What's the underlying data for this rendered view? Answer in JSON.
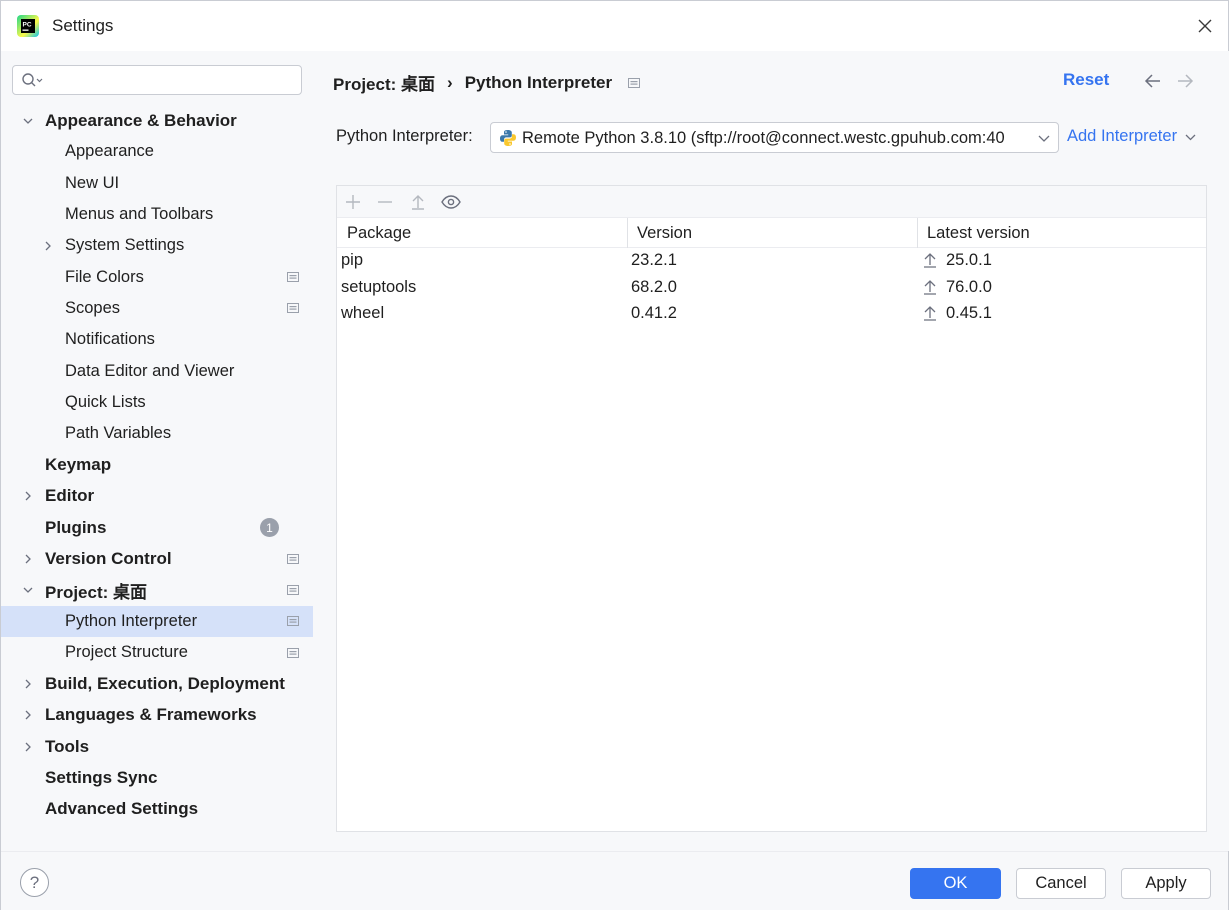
{
  "window": {
    "title": "Settings"
  },
  "search": {
    "placeholder": "",
    "value": ""
  },
  "sidebar": {
    "items": [
      {
        "label": "Appearance & Behavior",
        "level": 0,
        "chevron": "down"
      },
      {
        "label": "Appearance",
        "level": 1
      },
      {
        "label": "New UI",
        "level": 1
      },
      {
        "label": "Menus and Toolbars",
        "level": 1
      },
      {
        "label": "System Settings",
        "level": 1,
        "chevron": "right"
      },
      {
        "label": "File Colors",
        "level": 1,
        "badge": "project-scope-icon"
      },
      {
        "label": "Scopes",
        "level": 1,
        "badge": "project-scope-icon"
      },
      {
        "label": "Notifications",
        "level": 1
      },
      {
        "label": "Data Editor and Viewer",
        "level": 1
      },
      {
        "label": "Quick Lists",
        "level": 1
      },
      {
        "label": "Path Variables",
        "level": 1
      },
      {
        "label": "Keymap",
        "level": 0
      },
      {
        "label": "Editor",
        "level": 0,
        "chevron": "right"
      },
      {
        "label": "Plugins",
        "level": 0,
        "count": "1"
      },
      {
        "label": "Version Control",
        "level": 0,
        "chevron": "right",
        "badge": "project-scope-icon"
      },
      {
        "label": "Project: 桌面",
        "level": 0,
        "chevron": "down",
        "badge": "project-scope-icon"
      },
      {
        "label": "Python Interpreter",
        "level": 1,
        "selected": true,
        "badge": "project-scope-icon"
      },
      {
        "label": "Project Structure",
        "level": 1,
        "badge": "project-scope-icon"
      },
      {
        "label": "Build, Execution, Deployment",
        "level": 0,
        "chevron": "right"
      },
      {
        "label": "Languages & Frameworks",
        "level": 0,
        "chevron": "right"
      },
      {
        "label": "Tools",
        "level": 0,
        "chevron": "right"
      },
      {
        "label": "Settings Sync",
        "level": 0
      },
      {
        "label": "Advanced Settings",
        "level": 0
      }
    ]
  },
  "main": {
    "breadcrumb": {
      "parent": "Project: 桌面",
      "separator": "›",
      "current": "Python Interpreter"
    },
    "reset_label": "Reset",
    "interpreter_label": "Python Interpreter:",
    "interpreter_value": "Remote Python 3.8.10 (sftp://root@connect.westc.gpuhub.com:40",
    "add_interpreter_label": "Add Interpreter",
    "packages": {
      "columns": [
        "Package",
        "Version",
        "Latest version"
      ],
      "rows": [
        {
          "package": "pip",
          "version": "23.2.1",
          "latest": "25.0.1"
        },
        {
          "package": "setuptools",
          "version": "68.2.0",
          "latest": "76.0.0"
        },
        {
          "package": "wheel",
          "version": "0.41.2",
          "latest": "0.45.1"
        }
      ]
    }
  },
  "footer": {
    "help_label": "?",
    "ok_label": "OK",
    "cancel_label": "Cancel",
    "apply_label": "Apply"
  },
  "colors": {
    "accent": "#3574f0",
    "selection": "#d5e1f9",
    "badge": "#9aa0ab"
  }
}
